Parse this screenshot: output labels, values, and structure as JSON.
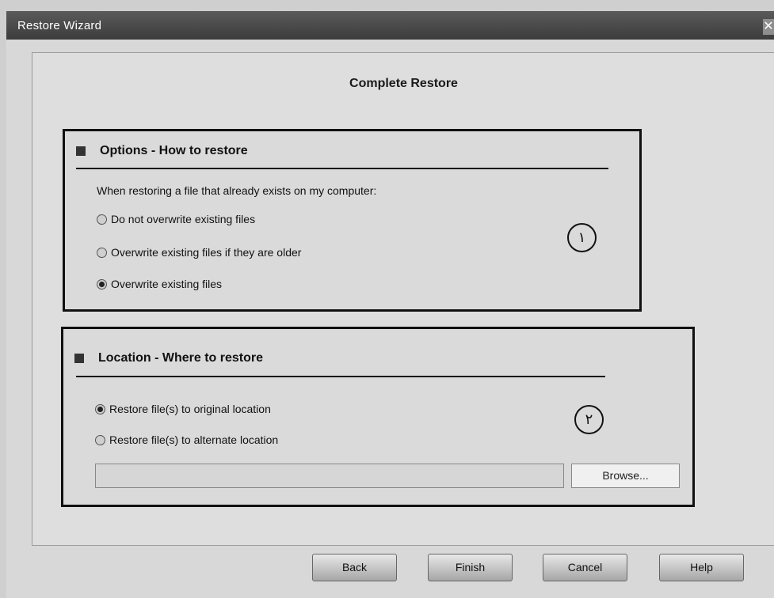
{
  "window": {
    "title": "Restore Wizard",
    "close_label": "✕"
  },
  "page": {
    "heading": "Complete Restore"
  },
  "options": {
    "title": "Options - How to restore",
    "prompt": "When restoring a file that already exists on my computer:",
    "choices": [
      {
        "label": "Do not overwrite existing files",
        "selected": false
      },
      {
        "label": "Overwrite existing files if they are older",
        "selected": false
      },
      {
        "label": "Overwrite existing files",
        "selected": true
      }
    ],
    "badge": "١"
  },
  "location": {
    "title": "Location - Where to restore",
    "choices": [
      {
        "label": "Restore file(s) to original location",
        "selected": true
      },
      {
        "label": "Restore file(s) to alternate location",
        "selected": false
      }
    ],
    "badge": "٢",
    "path_value": "",
    "browse_label": "Browse..."
  },
  "buttons": {
    "back": "Back",
    "finish": "Finish",
    "cancel": "Cancel",
    "help": "Help"
  }
}
